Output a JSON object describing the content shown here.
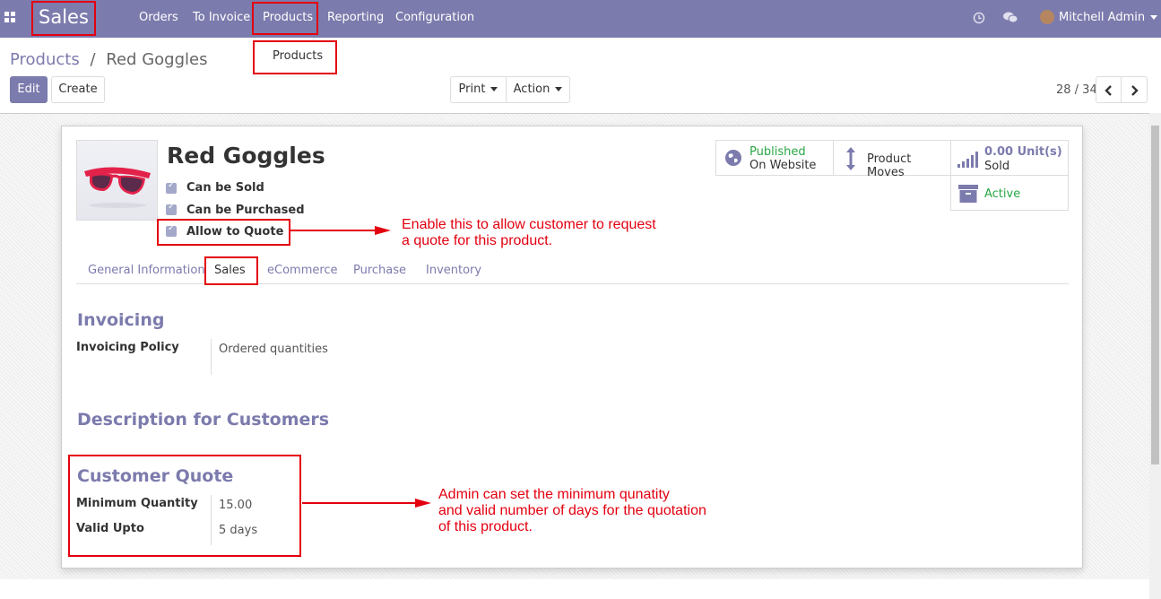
{
  "navbar": {
    "brand": "Sales",
    "menu": [
      "Orders",
      "To Invoice",
      "Products",
      "Reporting",
      "Configuration"
    ],
    "user": "Mitchell Admin"
  },
  "dropdown": {
    "item": "Products"
  },
  "breadcrumb": {
    "parent": "Products",
    "separator": "/",
    "current": "Red Goggles"
  },
  "controls": {
    "edit": "Edit",
    "create": "Create",
    "print": "Print",
    "action": "Action",
    "pager": "28 / 34"
  },
  "product": {
    "name": "Red Goggles",
    "checkboxes": [
      {
        "label": "Can be Sold",
        "checked": true
      },
      {
        "label": "Can be Purchased",
        "checked": true
      },
      {
        "label": "Allow to Quote",
        "checked": true
      }
    ]
  },
  "smart_buttons": {
    "published_line1": "Published",
    "published_line2": "On Website",
    "moves": "Product Moves",
    "sold_value": "0.00",
    "sold_unit": "Unit(s)",
    "sold_label": "Sold",
    "active": "Active"
  },
  "tabs": [
    "General Information",
    "Sales",
    "eCommerce",
    "Purchase",
    "Inventory"
  ],
  "invoicing": {
    "title": "Invoicing",
    "policy_label": "Invoicing Policy",
    "policy_value": "Ordered quantities"
  },
  "description": {
    "title": "Description for Customers"
  },
  "quote": {
    "title": "Customer Quote",
    "min_qty_label": "Minimum Quantity",
    "min_qty_value": "15.00",
    "valid_label": "Valid Upto",
    "valid_value": "5 days"
  },
  "annotations": {
    "quote_line1": "Enable this to allow customer to request",
    "quote_line2": "a quote for this product.",
    "admin_line1": "Admin can set the minimum qunatity",
    "admin_line2": "and valid number of days for the quotation",
    "admin_line3": "of this product."
  },
  "colors": {
    "brand": "#7c7bad",
    "annotation": "#e3000f",
    "success": "#28a745"
  }
}
